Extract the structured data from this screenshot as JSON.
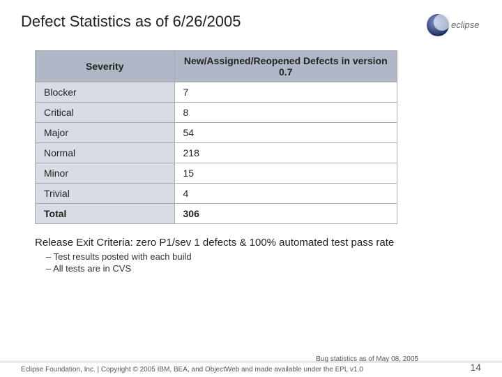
{
  "header": {
    "title": "Defect Statistics as of 6/26/2005"
  },
  "table": {
    "col1_header": "Severity",
    "col2_header": "New/Assigned/Reopened Defects in version 0.7",
    "rows": [
      {
        "severity": "Blocker",
        "count": "7"
      },
      {
        "severity": "Critical",
        "count": "8"
      },
      {
        "severity": "Major",
        "count": "54"
      },
      {
        "severity": "Normal",
        "count": "218"
      },
      {
        "severity": "Minor",
        "count": "15"
      },
      {
        "severity": "Trivial",
        "count": "4"
      },
      {
        "severity": "Total",
        "count": "306"
      }
    ]
  },
  "release": {
    "title": "Release Exit Criteria: zero P1/sev 1 defects & 100% automated test pass rate",
    "bullet1": "– Test results posted with each build",
    "bullet2": "– All tests are in CVS"
  },
  "footer": {
    "left": "Eclipse Foundation, Inc. | Copyright © 2005 IBM, BEA, and ObjectWeb and made available under the EPL v1.0",
    "bug_stats": "Bug statistics as of May 08, 2005",
    "page_number": "14"
  }
}
